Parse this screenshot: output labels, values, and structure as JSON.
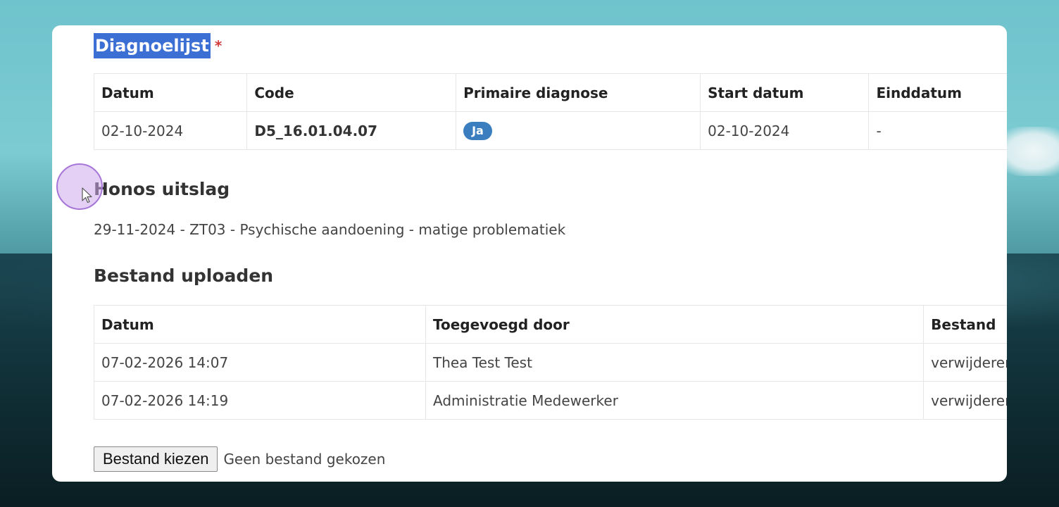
{
  "diagnosis": {
    "title": "Diagnoelijst",
    "required_mark": "*",
    "headers": [
      "Datum",
      "Code",
      "Primaire diagnose",
      "Start datum",
      "Einddatum"
    ],
    "row": {
      "datum": "02-10-2024",
      "code": "D5_16.01.04.07",
      "primaire": "Ja",
      "start": "02-10-2024",
      "eind": "-"
    }
  },
  "honos": {
    "title": "Honos uitslag",
    "text": "29-11-2024 - ZT03 - Psychische aandoening - matige problematiek"
  },
  "upload": {
    "title": "Bestand uploaden",
    "headers": [
      "Datum",
      "Toegevoegd door",
      "Bestand"
    ],
    "rows": [
      {
        "datum": "07-02-2026 14:07",
        "door": "Thea Test Test",
        "actie": "verwijderen"
      },
      {
        "datum": "07-02-2026 14:19",
        "door": "Administratie Medewerker",
        "actie": "verwijderen"
      }
    ],
    "choose_button": "Bestand kiezen",
    "no_file": "Geen bestand gekozen"
  },
  "colors": {
    "badge": "#3a7ebf",
    "title_highlight": "#3b6fd4",
    "required": "#d23b3b"
  }
}
